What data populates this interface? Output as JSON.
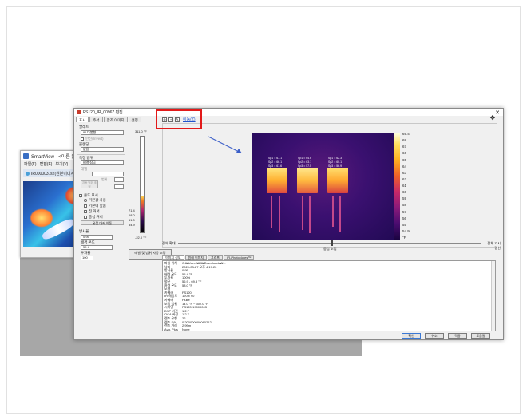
{
  "background_window": {
    "title": "SmartView - <이름 없음>",
    "menu": [
      "파일(F)",
      "편집(E)",
      "보기(V)"
    ],
    "tab_label": "IR000003.is2(원본이미지)"
  },
  "main_window": {
    "title": "FS120_IR_00967 편집",
    "tabs": [
      "표시",
      "주석",
      "참조 이미지",
      "설정"
    ],
    "toolbar_link": "이동(Z)",
    "ghost_label": "IR/Fusion 보기",
    "palette_label": "팔레트"
  },
  "left_panel": {
    "palette_section": "팔레트",
    "palette_value": "IR 다봉형",
    "invert_label": "반전(Invert)",
    "blend_label": "블렌딩",
    "blend_value": "없음",
    "range_section": "측정 범위",
    "range_value": "배열/잠금",
    "level_label": "레벨",
    "span_label": "범위",
    "auto_label": "자동 범위 조정",
    "temp_section": "온도 표시",
    "options": [
      "기본값 사용",
      "기본에 맞춤",
      "전 커서",
      "중심 커서",
      "온점 마커 이동"
    ],
    "emissivity_section": "방사율",
    "emissivity_value": "0.95",
    "bg_temp_label": "배경 온도",
    "bg_temp_value": "55.4",
    "trans_label": "투과율",
    "trans_value": "100"
  },
  "scale": {
    "top": "311.0 °F",
    "bottom": "-22.0 °F",
    "marks": [
      "71.4",
      "68.0",
      "61.0",
      "54.9"
    ],
    "adjust_button": "레벨 및 범위 자동 조정"
  },
  "thermal_image": {
    "point_labels": [
      "Sp1 = 67.1",
      "Sp2 = 66.1",
      "Sp3 = 61.6",
      "Sp1 = 64.6",
      "Sp2 = 63.1",
      "Sp3 = 57.5",
      "Sp1 = 62.3",
      "Sp2 = 60.1",
      "Sp3 = 56.9"
    ],
    "colorbar_labels": [
      "69.4",
      "68",
      "67",
      "66",
      "65",
      "64",
      "63",
      "62",
      "61",
      "60",
      "59",
      "58",
      "57",
      "56",
      "55",
      "54.9",
      "°F"
    ]
  },
  "focus_slider": {
    "left_label": "전체 확대",
    "mid_label": "중심 초점",
    "right_label": "전체 가시광선"
  },
  "info_tabs": [
    "이미지 정보",
    "원래 이미지",
    "그래프",
    "IR-PhotoNotes™"
  ],
  "info_rows": [
    [
      "파일 위치",
      "C:₩Users₩fl₩Downloads₩..."
    ],
    [
      "날짜",
      "2020-03-27 오후 4:17:20"
    ],
    [
      "방사율",
      "0.95"
    ],
    [
      "배경 온도",
      "55.4 °F"
    ],
    [
      "투과율",
      "100%"
    ],
    [
      "평균",
      "56.9 - 69.3 °F"
    ],
    [
      "환경 온도",
      "58.0 °F"
    ],
    [
      "모델",
      ""
    ],
    [
      "카메라",
      "FS120"
    ],
    [
      "IR 해상도",
      "120 x 90"
    ],
    [
      "카메라",
      "Fluke"
    ],
    [
      "보정 범위",
      "14.0 °F ~ 302.0 °F"
    ],
    [
      "시리얼",
      "FS120-19000003"
    ],
    [
      "DSP 버전",
      "1.2.7"
    ],
    [
      "OCA 버전",
      "1.2.7"
    ],
    [
      "렌즈 유형",
      "22"
    ],
    [
      "렌즈 S/N",
      "0.200000000060212"
    ],
    [
      "렌즈 거리",
      "2.99m"
    ],
    [
      "Avg. Plus",
      "None"
    ]
  ],
  "buttons": [
    "확인",
    "취소",
    "적용",
    "도움말"
  ]
}
